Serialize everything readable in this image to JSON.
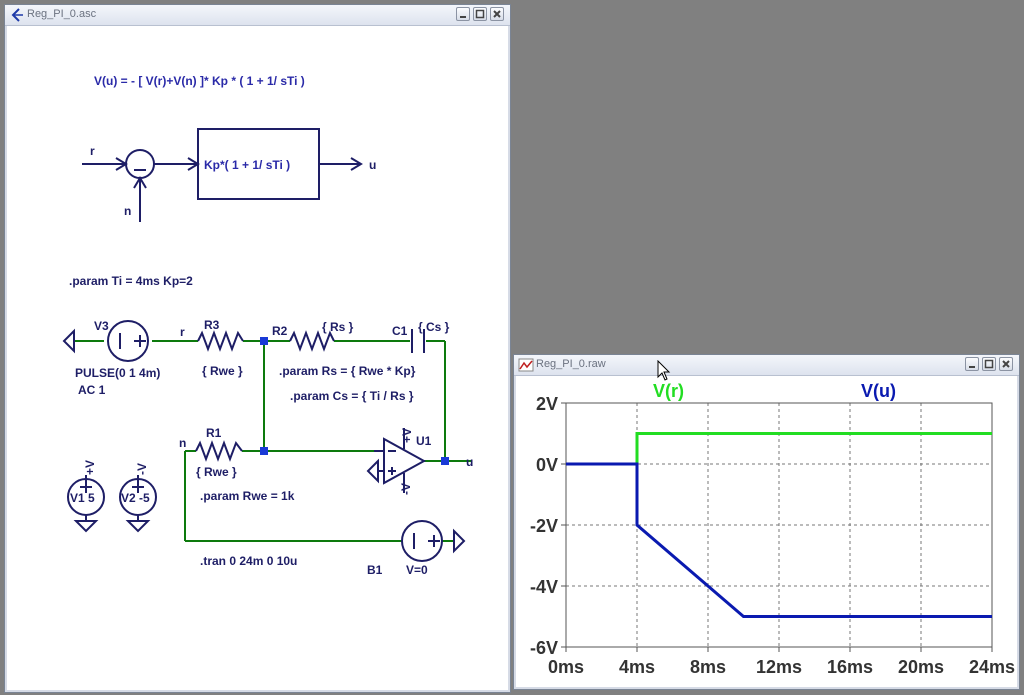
{
  "schematic_window": {
    "title": "Reg_PI_0.asc",
    "equation": "V(u) = - [ V(r)+V(n)  ]* Kp * ( 1 + 1/ sTi )",
    "block": {
      "input_r": "r",
      "input_n": "n",
      "output_u": "u",
      "transfer": "Kp*( 1 +  1/ sTi  )"
    },
    "params_line": ".param  Ti = 4ms  Kp=2",
    "labels": {
      "v3": "V3",
      "v3_pulse": "PULSE(0 1 4m)",
      "v3_ac": "AC 1",
      "net_r": "r",
      "r3": "R3",
      "r3_val": "{ Rwe }",
      "r2": "R2",
      "r2_val": "{ Rs }",
      "c1": "C1",
      "c1_val": "{ Cs }",
      "param_rs": ".param Rs = { Rwe * Kp}",
      "param_cs": ".param Cs = { Ti / Rs }",
      "net_n": "n",
      "r1": "R1",
      "r1_val": "{ Rwe }",
      "param_rwe": ".param Rwe = 1k",
      "u1": "U1",
      "plus_v": "+V",
      "minus_v": "-V",
      "net_u": "u",
      "v1": "V1  5",
      "v2": "V2 -5",
      "v1_top": "+V",
      "v2_top": "-V",
      "tran": ".tran 0 24m 0 10u",
      "b1": "B1",
      "b1_val": "V=0"
    }
  },
  "plot_window": {
    "title": "Reg_PI_0.raw",
    "trace_labels": [
      "V(r)",
      "V(u)"
    ]
  },
  "colors": {
    "trace_vr": "#22dd22",
    "trace_vu": "#0a1ab0",
    "wire": "#0d7a0d",
    "component": "#1e1e66",
    "node": "#1a3ad6"
  },
  "chart_data": {
    "type": "line",
    "title": "",
    "xlabel": "",
    "ylabel": "",
    "xlim": [
      0,
      24
    ],
    "ylim": [
      -6,
      2
    ],
    "x_ticks": [
      "0ms",
      "4ms",
      "8ms",
      "12ms",
      "16ms",
      "20ms",
      "24ms"
    ],
    "y_ticks": [
      "2V",
      "0V",
      "-2V",
      "-4V",
      "-6V"
    ],
    "grid": true,
    "series": [
      {
        "name": "V(r)",
        "x": [
          0,
          4,
          4,
          24
        ],
        "y": [
          0,
          0,
          1,
          1
        ]
      },
      {
        "name": "V(u)",
        "x": [
          0,
          4,
          4,
          10,
          24
        ],
        "y": [
          0,
          0,
          -2,
          -5,
          -5
        ]
      }
    ]
  }
}
